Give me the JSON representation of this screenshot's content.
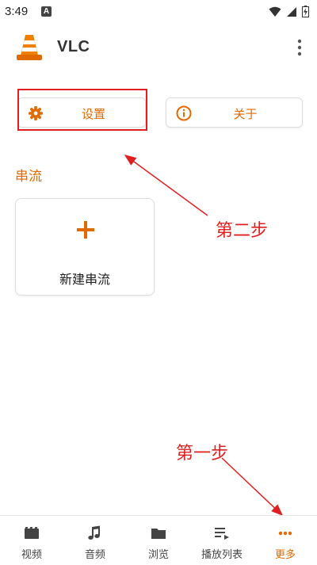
{
  "status_bar": {
    "time": "3:49",
    "badge": "A"
  },
  "app_bar": {
    "title": "VLC"
  },
  "actions": {
    "settings_label": "设置",
    "about_label": "关于"
  },
  "streams": {
    "section_title": "串流",
    "new_stream_label": "新建串流"
  },
  "annotations": {
    "step_two": "第二步",
    "step_one": "第一步"
  },
  "bottom_nav": [
    {
      "label": "视频",
      "icon": "video-icon"
    },
    {
      "label": "音频",
      "icon": "music-note-icon"
    },
    {
      "label": "浏览",
      "icon": "folder-icon"
    },
    {
      "label": "播放列表",
      "icon": "playlist-icon"
    },
    {
      "label": "更多",
      "icon": "more-dots-icon",
      "active": true
    }
  ],
  "colors": {
    "accent": "#e06a00",
    "annotation": "#e02020",
    "icon_gray": "#444444"
  }
}
